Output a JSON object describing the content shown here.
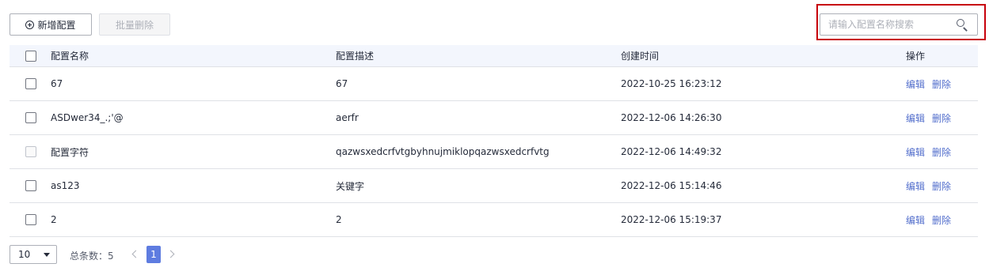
{
  "toolbar": {
    "add_label": "新增配置",
    "batch_delete_label": "批量删除"
  },
  "search": {
    "placeholder": "请输入配置名称搜索",
    "value": ""
  },
  "table": {
    "headers": {
      "name": "配置名称",
      "description": "配置描述",
      "created_time": "创建时间",
      "actions": "操作"
    },
    "rows": [
      {
        "name": "67",
        "description": "67",
        "created_time": "2022-10-25 16:23:12",
        "edit": "编辑",
        "delete": "删除"
      },
      {
        "name": "ASDwer34_.;'@",
        "description": "aerfr",
        "created_time": "2022-12-06 14:26:30",
        "edit": "编辑",
        "delete": "删除"
      },
      {
        "name": "配置字符",
        "description": "qazwsxedcrfvtgbyhnujmiklopqazwsxedcrfvtg",
        "created_time": "2022-12-06 14:49:32",
        "edit": "编辑",
        "delete": "删除"
      },
      {
        "name": "as123",
        "description": "关键字",
        "created_time": "2022-12-06 15:14:46",
        "edit": "编辑",
        "delete": "删除"
      },
      {
        "name": "2",
        "description": "2",
        "created_time": "2022-12-06 15:19:37",
        "edit": "编辑",
        "delete": "删除"
      }
    ]
  },
  "pagination": {
    "page_size": "10",
    "total_label": "总条数：5",
    "current_page": "1"
  },
  "colors": {
    "accent": "#5e7ce0",
    "link": "#526ecc",
    "highlight_border": "#c7000b",
    "header_bg": "#f3f6fd"
  }
}
